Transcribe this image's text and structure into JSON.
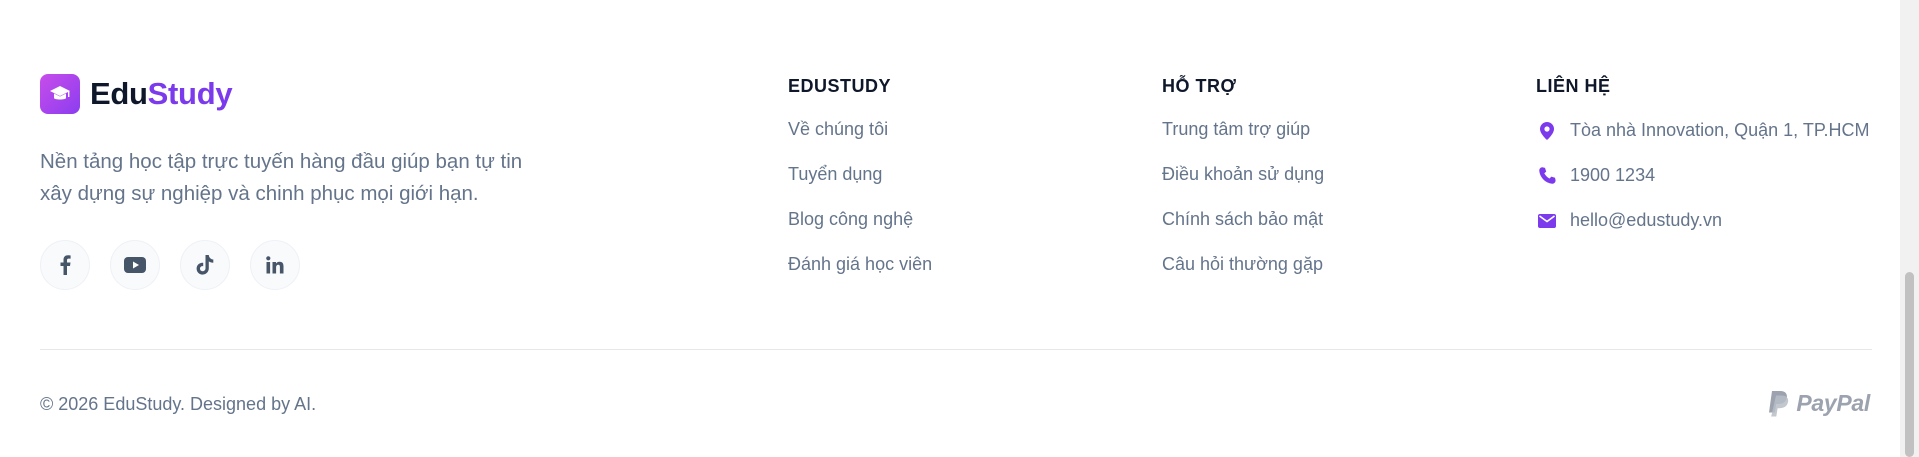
{
  "brand": {
    "name_part1": "Edu",
    "name_part2": "Study"
  },
  "description": "Nền tảng học tập trực tuyến hàng đầu giúp bạn tự tin xây dựng sự nghiệp và chinh phục mọi giới hạn.",
  "social": [
    {
      "icon": "facebook-icon"
    },
    {
      "icon": "youtube-icon"
    },
    {
      "icon": "tiktok-icon"
    },
    {
      "icon": "linkedin-icon"
    }
  ],
  "columns": {
    "edustudy": {
      "title": "EDUSTUDY",
      "links": [
        "Về chúng tôi",
        "Tuyển dụng",
        "Blog công nghệ",
        "Đánh giá học viên"
      ]
    },
    "support": {
      "title": "HỖ TRỢ",
      "links": [
        "Trung tâm trợ giúp",
        "Điều khoản sử dụng",
        "Chính sách bảo mật",
        "Câu hỏi thường gặp"
      ]
    },
    "contact": {
      "title": "LIÊN HỆ",
      "items": [
        {
          "icon": "location-pin-icon",
          "text": "Tòa nhà Innovation, Quận 1, TP.HCM"
        },
        {
          "icon": "phone-icon",
          "text": "1900 1234"
        },
        {
          "icon": "envelope-icon",
          "text": "hello@edustudy.vn"
        }
      ]
    }
  },
  "copyright": "© 2026 EduStudy. Designed by AI.",
  "payment": {
    "label": "PayPal"
  },
  "colors": {
    "accent": "#7c3aed",
    "heading": "#0f172a",
    "text": "#64748b",
    "divider": "#e5e7eb"
  }
}
